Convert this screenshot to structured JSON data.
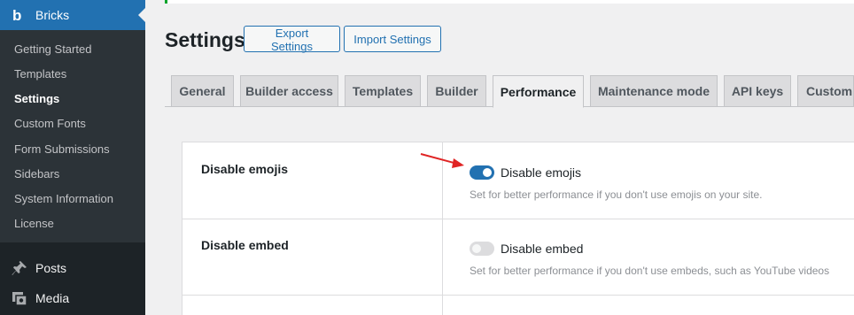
{
  "sidebar": {
    "brand_logo": "b",
    "brand": "Bricks",
    "submenu": [
      {
        "label": "Getting Started",
        "active": false
      },
      {
        "label": "Templates",
        "active": false
      },
      {
        "label": "Settings",
        "active": true
      },
      {
        "label": "Custom Fonts",
        "active": false
      },
      {
        "label": "Form Submissions",
        "active": false
      },
      {
        "label": "Sidebars",
        "active": false
      },
      {
        "label": "System Information",
        "active": false
      },
      {
        "label": "License",
        "active": false
      }
    ],
    "menu": [
      {
        "label": "Posts",
        "icon": "pushpin-icon"
      },
      {
        "label": "Media",
        "icon": "media-icon"
      }
    ]
  },
  "header": {
    "title": "Settings",
    "export_label": "Export Settings",
    "import_label": "Import Settings"
  },
  "tabs": [
    {
      "label": "General",
      "active": false
    },
    {
      "label": "Builder access",
      "active": false
    },
    {
      "label": "Templates",
      "active": false
    },
    {
      "label": "Builder",
      "active": false
    },
    {
      "label": "Performance",
      "active": true
    },
    {
      "label": "Maintenance mode",
      "active": false
    },
    {
      "label": "API keys",
      "active": false
    },
    {
      "label": "Custom c",
      "active": false
    }
  ],
  "settings": [
    {
      "label": "Disable emojis",
      "toggle_label": "Disable emojis",
      "enabled": true,
      "description": "Set for better performance if you don't use emojis on your site."
    },
    {
      "label": "Disable embed",
      "toggle_label": "Disable embed",
      "enabled": false,
      "description": "Set for better performance if you don't use embeds, such as YouTube videos"
    }
  ],
  "colors": {
    "accent": "#2271b1",
    "sidebar_bg": "#1d2327",
    "annotation_arrow": "#e02424"
  }
}
